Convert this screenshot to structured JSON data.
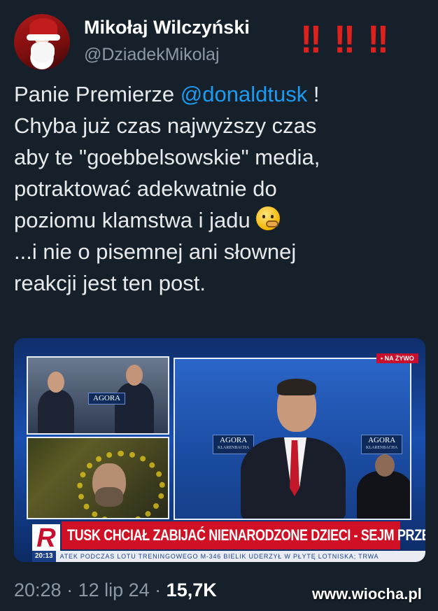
{
  "author": {
    "name": "Mikołaj Wilczyński",
    "handle": "@DziadekMikolaj",
    "avatar_icon": "santa-avatar-icon"
  },
  "decoration": {
    "bangs": [
      "‼",
      "‼",
      "‼"
    ],
    "color": "#e0201c"
  },
  "tweet": {
    "line1_before": "Panie Premierze ",
    "mention": "@donaldtusk",
    "line1_after": " !",
    "body": "Chyba już czas najwyższy czas\naby te \"goebbelsowskie\" media,\npotraktować adekwatnie do\npoziomu klamstwa i jadu ",
    "emoji": "thinking-face-emoji",
    "tail": "\n...i nie o pisemnej ani słownej\nreakcji jest ten post."
  },
  "media": {
    "live_badge": "• NA ŻYWO",
    "agora_label": "AGORA",
    "agora_sub": "KLARENBACHA",
    "headline": "TUSK CHCIAŁ ZABIJAĆ NIENARODZONE DZIECI - SEJM PRZECIW",
    "logo_letter": "R",
    "ticker_time": "20:13",
    "ticker_text": "ATEK PODCZAS LOTU TRENINGOWEGO M-346 BIELIK UDERZYŁ W PŁYTĘ LOTNISKA; TRWA"
  },
  "meta": {
    "time": "20:28",
    "sep": " · ",
    "date": "12 lip 24",
    "views": "15,7K"
  },
  "watermark": "www.wiocha.pl",
  "colors": {
    "background": "#15202b",
    "mention": "#1d9bf0",
    "muted": "#8b98a5",
    "headline_bg": "#d01024"
  }
}
